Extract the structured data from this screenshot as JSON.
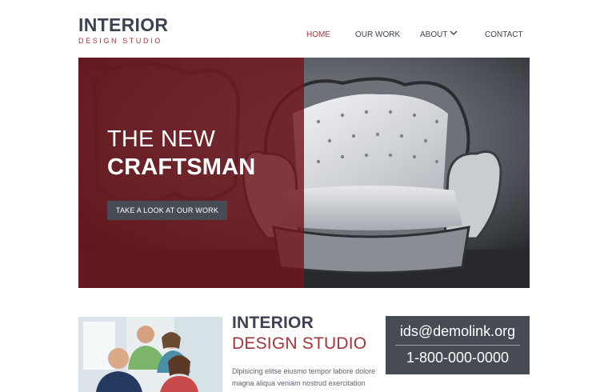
{
  "brand": {
    "title": "INTERIOR",
    "subtitle": "DESIGN STUDIO"
  },
  "nav": {
    "items": [
      {
        "label": "HOME",
        "active": true
      },
      {
        "label": "OUR WORK",
        "active": false
      },
      {
        "label": "ABOUT",
        "active": false,
        "has_dropdown": true
      },
      {
        "label": "CONTACT",
        "active": false
      }
    ]
  },
  "hero": {
    "line1": "THE NEW",
    "line2": "CRAFTSMAN",
    "button_label": "TAKE A LOOK AT OUR WORK",
    "image": "ornate-white-armchair-photo"
  },
  "about": {
    "image": "team-photo",
    "title": "INTERIOR",
    "subtitle": "DESIGN STUDIO",
    "text": "Dipisicing elitse eiusmo tempor labore dolore magna aliqua veniam nostrud exercitation"
  },
  "contact": {
    "email": "ids@demolink.org",
    "phone": "1-800-000-0000"
  },
  "colors": {
    "accent": "#a8323a",
    "dark": "#3d4350",
    "panel": "#474b54",
    "overlay": "#70161c"
  },
  "icons": {
    "about_dropdown": "chevron-down-icon"
  }
}
